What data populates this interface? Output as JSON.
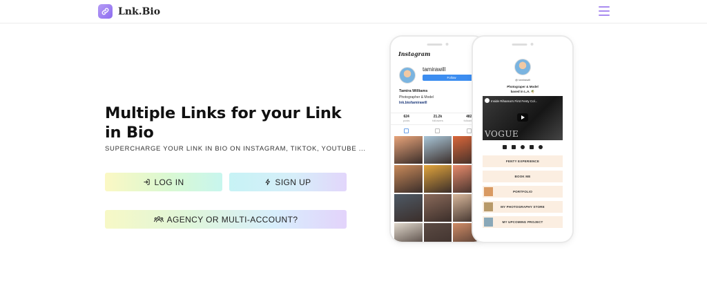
{
  "brand": {
    "name": "Lnk.Bio",
    "logo_icon": "link-icon",
    "accent": "#9b7bf2"
  },
  "nav": {
    "menu_icon": "hamburger-menu-icon"
  },
  "hero": {
    "title": "Multiple Links for your Link in Bio",
    "subtitle": "SUPERCHARGE YOUR LINK IN BIO ON INSTAGRAM, TIKTOK, YOUTUBE ..."
  },
  "buttons": {
    "login": {
      "label": "LOG IN",
      "icon": "login-icon"
    },
    "signup": {
      "label": "SIGN UP",
      "icon": "bolt-icon"
    },
    "agency": {
      "label": "AGENCY OR MULTI-ACCOUNT?",
      "icon": "users-icon"
    }
  },
  "instagram_mock": {
    "logo": "Instagram",
    "handle": "tamirawill",
    "follow_label": "Follow",
    "name": "Tamira Williams",
    "bio": "Photographer & Model",
    "link": "lnk.bio/tamirawill",
    "stats": [
      {
        "value": "624",
        "label": "posts"
      },
      {
        "value": "21.2k",
        "label": "followers"
      },
      {
        "value": "482",
        "label": "following"
      }
    ],
    "grid_colors": [
      "#e8a47a",
      "#a9c6d8",
      "#d9663a",
      "#c98a5a",
      "#e2a53c",
      "#e78a6b",
      "#4e5a66",
      "#8a6a5a",
      "#d8b79a",
      "#e0d8cc",
      "#5c4b44",
      "#cf8b66"
    ]
  },
  "linkbio_mock": {
    "handle": "@ tamirawill",
    "bio_line1": "Photograper & Model",
    "bio_line2": "based in L.A. 🌴",
    "video_title": "Inside Rihanna's First Fenty Col...",
    "video_brand": "VOGUE",
    "links": [
      {
        "label": "FENTY EXPERIENCE",
        "thumb": ""
      },
      {
        "label": "BOOK ME",
        "thumb": ""
      },
      {
        "label": "PORTFOLIO",
        "thumb": "#d99a62"
      },
      {
        "label": "MY PHOTOGRAPHY STORE",
        "thumb": "#b89a6a"
      },
      {
        "label": "MY UPCOMING PROJECT",
        "thumb": "#8aa8b8"
      }
    ]
  }
}
